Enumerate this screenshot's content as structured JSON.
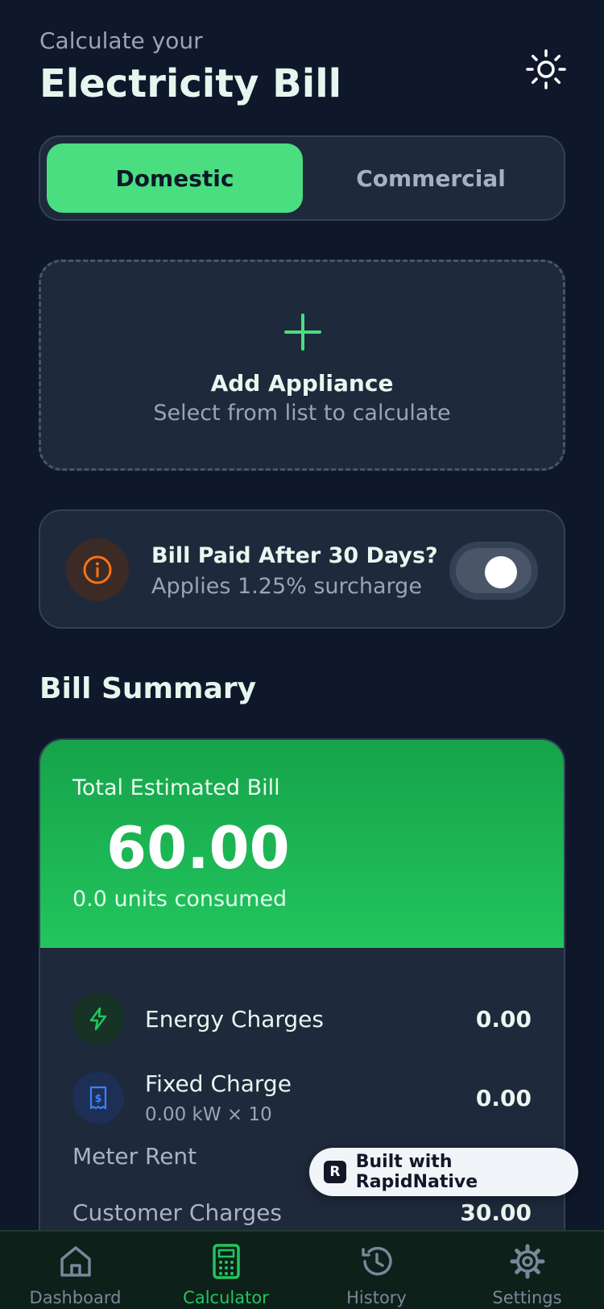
{
  "header": {
    "subtitle": "Calculate your",
    "title": "Electricity Bill",
    "theme_icon": "sun-icon"
  },
  "segment": {
    "options": [
      "Domestic",
      "Commercial"
    ],
    "selected": "Domestic"
  },
  "add_appliance": {
    "title": "Add Appliance",
    "subtitle": "Select from list to calculate",
    "icon": "plus-icon"
  },
  "surcharge": {
    "title": "Bill Paid After 30 Days?",
    "subtitle": "Applies 1.25% surcharge",
    "enabled": false,
    "icon": "info-icon"
  },
  "summary": {
    "heading": "Bill Summary",
    "total_label": "Total Estimated Bill",
    "total_value": "60.00",
    "units": "0.0 units consumed",
    "energy": {
      "label": "Energy Charges",
      "value": "0.00",
      "icon": "bolt-icon"
    },
    "fixed": {
      "label": "Fixed Charge",
      "sub": "0.00 kW ×   10",
      "value": "0.00",
      "icon": "receipt-icon"
    },
    "meter_rent": {
      "label": "Meter Rent"
    },
    "customer": {
      "label": "Customer Charges",
      "value": "30.00"
    }
  },
  "badge": {
    "text": "Built with RapidNative",
    "logo": "R"
  },
  "nav": {
    "items": [
      {
        "label": "Dashboard",
        "icon": "home-icon"
      },
      {
        "label": "Calculator",
        "icon": "calculator-icon"
      },
      {
        "label": "History",
        "icon": "history-icon"
      },
      {
        "label": "Settings",
        "icon": "gear-icon"
      }
    ],
    "active": "Calculator"
  },
  "colors": {
    "background": "#0f172a",
    "card": "#1e293b",
    "accent": "#4ade80",
    "summary_green": "#22c55e",
    "warning": "#f97316"
  }
}
